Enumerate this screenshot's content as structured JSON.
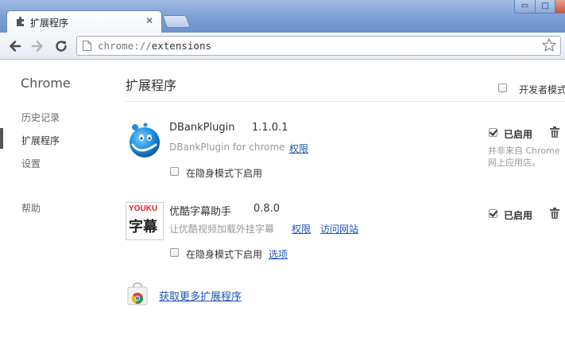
{
  "tab": {
    "title": "扩展程序",
    "close_glyph": "✕"
  },
  "window_controls": {
    "minimize_glyph": "▭",
    "maximize_glyph": "□"
  },
  "toolbar": {
    "url_scheme": "chrome://",
    "url_path": "extensions"
  },
  "sidebar": {
    "brand": "Chrome",
    "items": [
      {
        "label": "历史记录"
      },
      {
        "label": "扩展程序"
      },
      {
        "label": "设置"
      },
      {
        "label": "帮助"
      }
    ]
  },
  "main": {
    "title": "扩展程序",
    "developer_mode_label": "开发者模式",
    "extensions": [
      {
        "name": "DBankPlugin",
        "version": "1.1.0.1",
        "description": "DBankPlugin for chrome",
        "permissions_link": "权限",
        "incognito_label": "在隐身模式下启用",
        "enabled_label": "已启用",
        "note_line1": "并非来自 Chrome",
        "note_line2": "网上应用店。",
        "icon": "dbank-globe-icon"
      },
      {
        "name": "优酷字幕助手",
        "version": "0.8.0",
        "description": "让优酷视频加载外挂字幕",
        "permissions_link": "权限",
        "website_link": "访问网站",
        "incognito_label": "在隐身模式下启用",
        "options_link": "选项",
        "enabled_label": "已启用",
        "icon_brand_text": "YOUKU",
        "icon_caption": "字幕"
      }
    ],
    "get_more_link": "获取更多扩展程序"
  },
  "colors": {
    "link": "#1c55bd",
    "titlebar": "#7a9ed4"
  }
}
